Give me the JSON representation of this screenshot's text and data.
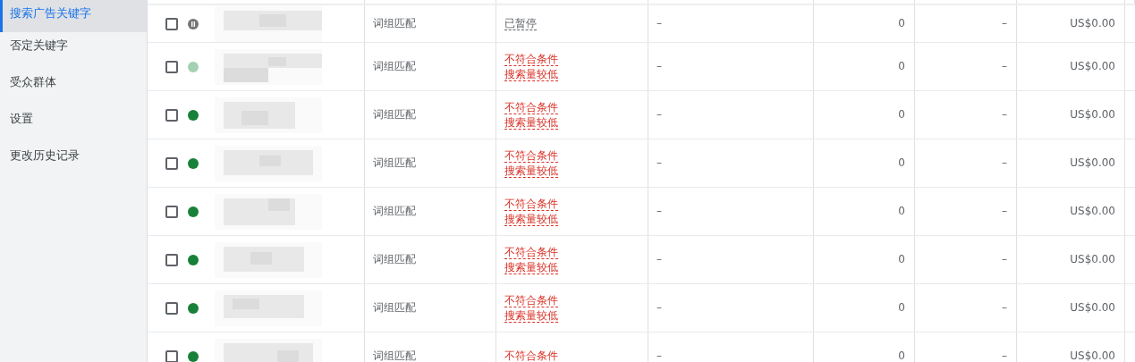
{
  "sidebar": {
    "items": [
      {
        "label": "搜索广告关键字",
        "selected": true
      },
      {
        "label": "否定关键字",
        "selected": false
      },
      {
        "label": "受众群体",
        "selected": false
      },
      {
        "label": "设置",
        "selected": false
      },
      {
        "label": "更改历史记录",
        "selected": false
      }
    ]
  },
  "table": {
    "rows": [
      {
        "checked": false,
        "kind": "paused",
        "faded": false,
        "match_type": "词组匹配",
        "status": {
          "kind": "paused",
          "lines": [
            "已暂停"
          ]
        },
        "column_6": "–",
        "column_7": "0",
        "column_8": "–",
        "column_9": "US$0.00"
      },
      {
        "checked": false,
        "kind": "enabled",
        "faded": true,
        "match_type": "词组匹配",
        "status": {
          "kind": "error",
          "lines": [
            "不符合条件",
            "搜索量较低"
          ]
        },
        "column_6": "–",
        "column_7": "0",
        "column_8": "–",
        "column_9": "US$0.00"
      },
      {
        "checked": false,
        "kind": "enabled",
        "faded": false,
        "match_type": "词组匹配",
        "status": {
          "kind": "error",
          "lines": [
            "不符合条件",
            "搜索量较低"
          ]
        },
        "column_6": "–",
        "column_7": "0",
        "column_8": "–",
        "column_9": "US$0.00"
      },
      {
        "checked": false,
        "kind": "enabled",
        "faded": false,
        "match_type": "词组匹配",
        "status": {
          "kind": "error",
          "lines": [
            "不符合条件",
            "搜索量较低"
          ]
        },
        "column_6": "–",
        "column_7": "0",
        "column_8": "–",
        "column_9": "US$0.00"
      },
      {
        "checked": false,
        "kind": "enabled",
        "faded": false,
        "match_type": "词组匹配",
        "status": {
          "kind": "error",
          "lines": [
            "不符合条件",
            "搜索量较低"
          ]
        },
        "column_6": "–",
        "column_7": "0",
        "column_8": "–",
        "column_9": "US$0.00"
      },
      {
        "checked": false,
        "kind": "enabled",
        "faded": false,
        "match_type": "词组匹配",
        "status": {
          "kind": "error",
          "lines": [
            "不符合条件",
            "搜索量较低"
          ]
        },
        "column_6": "–",
        "column_7": "0",
        "column_8": "–",
        "column_9": "US$0.00"
      },
      {
        "checked": false,
        "kind": "enabled",
        "faded": false,
        "match_type": "词组匹配",
        "status": {
          "kind": "error",
          "lines": [
            "不符合条件",
            "搜索量较低"
          ]
        },
        "column_6": "–",
        "column_7": "0",
        "column_8": "–",
        "column_9": "US$0.00"
      },
      {
        "checked": false,
        "kind": "enabled",
        "faded": false,
        "match_type": "词组匹配",
        "status": {
          "kind": "error",
          "lines": [
            "不符合条件"
          ]
        },
        "column_6": "–",
        "column_7": "0",
        "column_8": "–",
        "column_9": "US$0.00"
      }
    ]
  }
}
